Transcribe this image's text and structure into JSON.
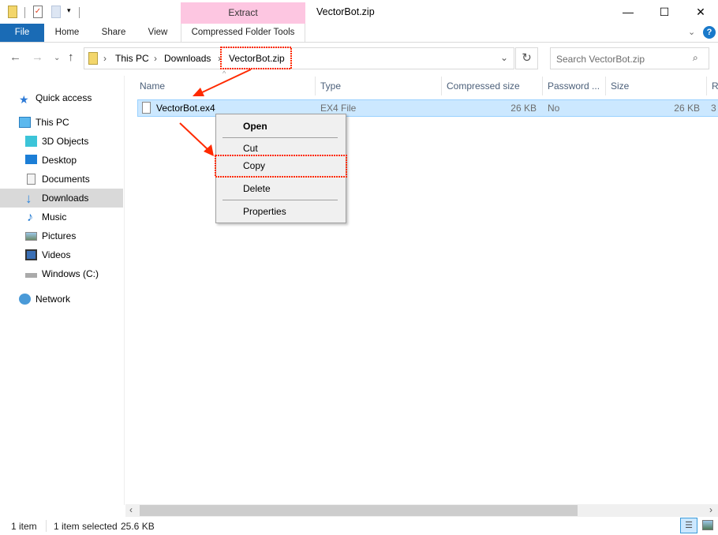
{
  "window": {
    "title": "VectorBot.zip",
    "minimize": "—",
    "maximize": "☐",
    "close": "✕"
  },
  "ribbon": {
    "context_group": "Extract",
    "tabs": [
      "File",
      "Home",
      "Share",
      "View",
      "Compressed Folder Tools"
    ],
    "help": "?"
  },
  "address": {
    "crumbs": [
      "This PC",
      "Downloads",
      "VectorBot.zip"
    ],
    "search_placeholder": "Search VectorBot.zip"
  },
  "sidebar": {
    "items": [
      {
        "label": "Quick access",
        "icon": "star-icon"
      },
      {
        "label": "This PC",
        "icon": "computer-icon"
      },
      {
        "label": "3D Objects",
        "icon": "cube-icon"
      },
      {
        "label": "Desktop",
        "icon": "desktop-icon"
      },
      {
        "label": "Documents",
        "icon": "document-icon"
      },
      {
        "label": "Downloads",
        "icon": "download-icon",
        "selected": true
      },
      {
        "label": "Music",
        "icon": "music-icon"
      },
      {
        "label": "Pictures",
        "icon": "pictures-icon"
      },
      {
        "label": "Videos",
        "icon": "videos-icon"
      },
      {
        "label": "Windows (C:)",
        "icon": "drive-icon"
      },
      {
        "label": "Network",
        "icon": "network-icon"
      }
    ]
  },
  "columns": [
    "Name",
    "Type",
    "Compressed size",
    "Password ...",
    "Size",
    "R"
  ],
  "files": [
    {
      "name": "VectorBot.ex4",
      "type": "EX4 File",
      "compressed": "26 KB",
      "password": "No",
      "size": "26 KB",
      "ratio": "3"
    }
  ],
  "context_menu": {
    "items": [
      "Open",
      "Cut",
      "Copy",
      "Delete",
      "Properties"
    ]
  },
  "status": {
    "count": "1 item",
    "selected": "1 item selected",
    "size": "25.6 KB"
  },
  "colors": {
    "accent": "#1979ca",
    "file_tab": "#1a6bb5",
    "selection": "#cce8ff",
    "context_tab": "#fdc6e1",
    "annotation": "#ff2a00"
  }
}
